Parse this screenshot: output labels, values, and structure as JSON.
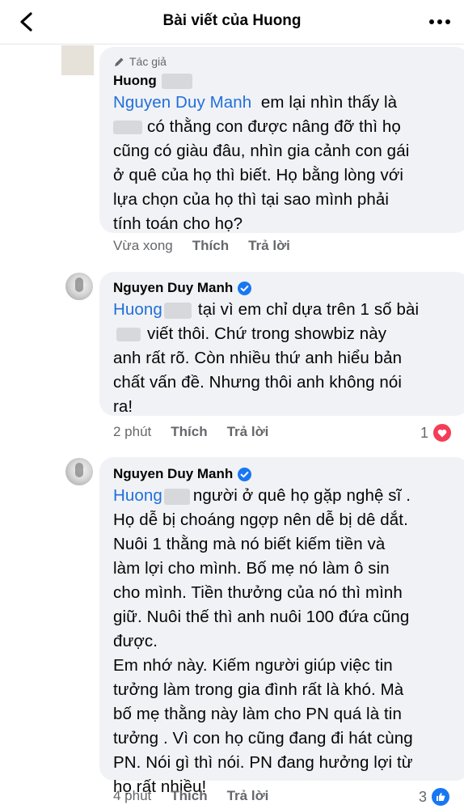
{
  "header": {
    "title": "Bài viết của Huong",
    "back_icon": "back-arrow-icon",
    "more_icon": "more-dots-icon"
  },
  "comments": [
    {
      "author_badge": "Tác giả",
      "name": "Huong",
      "tag": "Nguyen Duy Manh",
      "lines": [
        "em lại nhìn thấy là",
        "có thằng con được nâng đỡ thì họ",
        "cũng có giàu đâu, nhìn gia cảnh con gái",
        "ở quê của họ thì biết. Họ bằng lòng với",
        "lựa chọn của họ thì tại sao mình phải",
        "tính toán cho họ?"
      ],
      "time": "Vừa xong",
      "like_label": "Thích",
      "reply_label": "Trả lời"
    },
    {
      "name": "Nguyen Duy Manh",
      "tag": "Huong",
      "lines": [
        "tại vì em chỉ dựa trên 1 số bài",
        "viết thôi. Chứ trong showbiz này",
        "anh rất rõ. Còn nhiều thứ anh hiểu bản",
        "chất vấn đề. Nhưng thôi anh không nói",
        "ra!"
      ],
      "time": "2 phút",
      "like_label": "Thích",
      "reply_label": "Trả lời",
      "reaction_count": "1",
      "reaction_type": "heart-icon",
      "reaction_color": "#f33e58"
    },
    {
      "name": "Nguyen Duy Manh",
      "tag": "Huong",
      "lines": [
        "người ở quê họ gặp nghệ sĩ .",
        "Họ dễ bị choáng ngợp nên dễ bị dê dắt.",
        "Nuôi 1 thằng mà nó biết kiếm tiền và",
        "làm lợi cho mình. Bố mẹ nó làm ô sin",
        "cho mình. Tiền thưởng của nó thì mình",
        "giữ. Nuôi thế thì anh nuôi 100 đứa cũng",
        "được.",
        "Em nhớ này. Kiếm người giúp việc tin",
        "tưởng làm trong gia đình rất là khó. Mà",
        "bố mẹ thằng này làm cho PN quá là tin",
        "tưởng . Vì con họ cũng đang đi hát cùng",
        "PN. Nói gì thì nói. PN đang hưởng lợi từ",
        "họ rất nhiều!"
      ],
      "time": "4 phút",
      "like_label": "Thích",
      "reply_label": "Trả lời",
      "reaction_count": "3",
      "reaction_type": "thumbs-up-icon",
      "reaction_color": "#1877f2"
    }
  ],
  "colors": {
    "link": "#216fdb",
    "bubble": "#f0f2f5",
    "meta": "#65676b",
    "verified": "#1877f2"
  }
}
